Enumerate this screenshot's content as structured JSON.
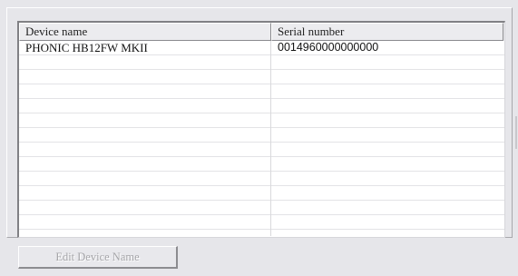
{
  "device_list": {
    "columns": [
      "Device name",
      "Serial number"
    ],
    "rows": [
      {
        "device_name": "PHONIC HB12FW MKII",
        "serial_number": "0014960000000000"
      }
    ]
  },
  "actions": {
    "edit_device_name": "Edit Device Name",
    "edit_device_name_enabled": false
  },
  "colors": {
    "window_background": "#e6e6ea",
    "list_background": "#ffffff",
    "header_background": "#ececef",
    "disabled_text": "#a4a4a8"
  }
}
